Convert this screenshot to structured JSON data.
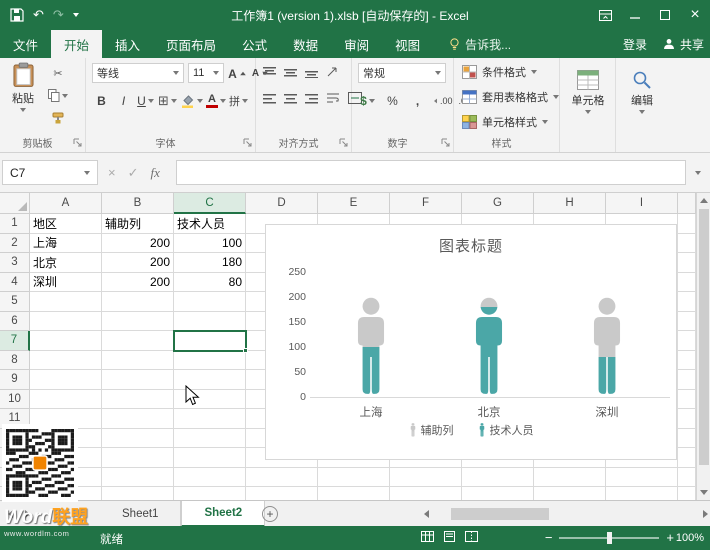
{
  "colors": {
    "excel_green": "#217346",
    "ribbon_bg": "#f3f3f3",
    "grid_line": "#dadada",
    "chart_text": "#595959",
    "person_gray": "#c9c9c9",
    "person_teal": "#4BA7A7",
    "watermark_orange": "#ffa21f"
  },
  "titlebar": {
    "title": "工作簿1 (version 1).xlsb [自动保存的] - Excel"
  },
  "ribbon": {
    "tabs": [
      "文件",
      "开始",
      "插入",
      "页面布局",
      "公式",
      "数据",
      "审阅",
      "视图"
    ],
    "active_tab_index": 1,
    "tell_me": "告诉我...",
    "sign_in": "登录",
    "share": "共享",
    "clipboard": {
      "label": "剪贴板",
      "paste": "粘贴"
    },
    "font": {
      "label": "字体",
      "name": "等线",
      "size": "11",
      "bold": "B",
      "italic": "I",
      "underline": "U",
      "color_letter": "A",
      "grow_letter": "A",
      "shrink_letter": "A",
      "phonetic": "拼"
    },
    "alignment": {
      "label": "对齐方式"
    },
    "number": {
      "label": "数字",
      "format": "常规",
      "currency": "$",
      "percent": "%",
      "comma": ",",
      "decimal": ".00"
    },
    "styles": {
      "label": "样式",
      "conditional": "条件格式",
      "format_table": "套用表格格式",
      "cell_styles": "单元格样式"
    },
    "cells_button": "单元格",
    "editing_button": "编辑"
  },
  "formula_bar": {
    "name_box": "C7",
    "fx_label": "fx",
    "value": ""
  },
  "grid": {
    "col_headers": [
      "A",
      "B",
      "C",
      "D",
      "E",
      "F",
      "G",
      "H",
      "I"
    ],
    "visible_rows": 15,
    "active_cell": {
      "ref": "C7",
      "col_index": 2,
      "row": 7
    },
    "cells": {
      "A1": "地区",
      "B1": "辅助列",
      "C1": "技术人员",
      "A2": "上海",
      "B2": "200",
      "C2": "100",
      "A3": "北京",
      "B3": "200",
      "C3": "180",
      "A4": "深圳",
      "B4": "200",
      "C4": "80"
    },
    "right_aligned": [
      "B2",
      "C2",
      "B3",
      "C3",
      "B4",
      "C4"
    ]
  },
  "chart_data": {
    "type": "bar",
    "subtype": "pictograph_stacked_people",
    "title": "图表标题",
    "categories": [
      "上海",
      "北京",
      "深圳"
    ],
    "series": [
      {
        "name": "辅助列",
        "values": [
          200,
          200,
          200
        ],
        "color": "#c9c9c9"
      },
      {
        "name": "技术人员",
        "values": [
          100,
          180,
          80
        ],
        "color": "#4BA7A7"
      }
    ],
    "ylim": [
      0,
      250
    ],
    "yticks": [
      250,
      200,
      150,
      100,
      50,
      0
    ],
    "gridlines": false,
    "legend_position": "bottom"
  },
  "sheet_bar": {
    "tabs": [
      "Sheet1",
      "Sheet2"
    ],
    "active_index": 1
  },
  "status_bar": {
    "mode": "就绪",
    "zoom_level": "100%"
  },
  "watermark": {
    "brand": "Word联盟",
    "brand_latin": "Word",
    "brand_cjk": "联盟",
    "url": "www.wordlm.com"
  },
  "icons": {
    "undo": "↶",
    "redo": "↷",
    "scissors": "✂",
    "check": "✓",
    "close": "×",
    "borders": "⊞",
    "add_sheet": "+",
    "zoom_out": "−",
    "zoom_in": "+"
  }
}
